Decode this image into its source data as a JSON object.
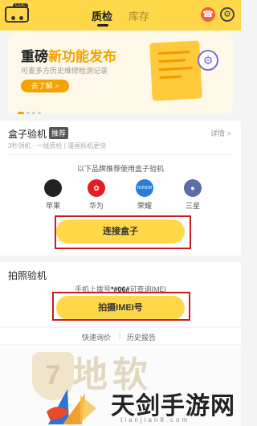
{
  "header": {
    "logo_pill": "CDC",
    "tabs": [
      {
        "label": "质检",
        "active": true
      },
      {
        "label": "库存",
        "active": false
      }
    ],
    "service_icon": "headset-icon",
    "settings_icon": "gear-icon"
  },
  "banner": {
    "title_part1": "重磅",
    "title_highlight": "新功能发布",
    "subtitle": "可查多方历史维修检测记录",
    "button_label": "去了解 >",
    "colors": {
      "highlight": "#f2a300"
    }
  },
  "box_inspection": {
    "title": "盒子验机",
    "badge": "推荐",
    "detail_link": "详情 >",
    "subtitle": "3秒领机 · 一线质检 | 漫画拆机更快",
    "recommend_text": "以下品牌推荐使用盒子验机",
    "brands": [
      {
        "label": "苹果",
        "icon": "apple-icon",
        "color": "#222222",
        "glyph": ""
      },
      {
        "label": "华为",
        "icon": "huawei-icon",
        "color": "#e02020",
        "glyph": "✿"
      },
      {
        "label": "荣耀",
        "icon": "honor-icon",
        "color": "#2a7cd8",
        "glyph": "HONOR"
      },
      {
        "label": "三星",
        "icon": "samsung-icon",
        "color": "#5b6ea8",
        "glyph": "●"
      }
    ],
    "connect_button": "连接盒子"
  },
  "photo_inspection": {
    "title": "拍照验机",
    "hint_prefix": "手机上拨号",
    "hint_code": "*#06#",
    "hint_suffix": "可查询IMEI",
    "imei_button": "拍摄IMEI号"
  },
  "links": {
    "quick_price": "快速询价",
    "separator": "|",
    "history": "历史报告"
  },
  "watermark": {
    "shield_glyph": "7",
    "big_text": "泽地软",
    "site_name": "天剑手游网",
    "site_url": "tianjian8.com"
  }
}
